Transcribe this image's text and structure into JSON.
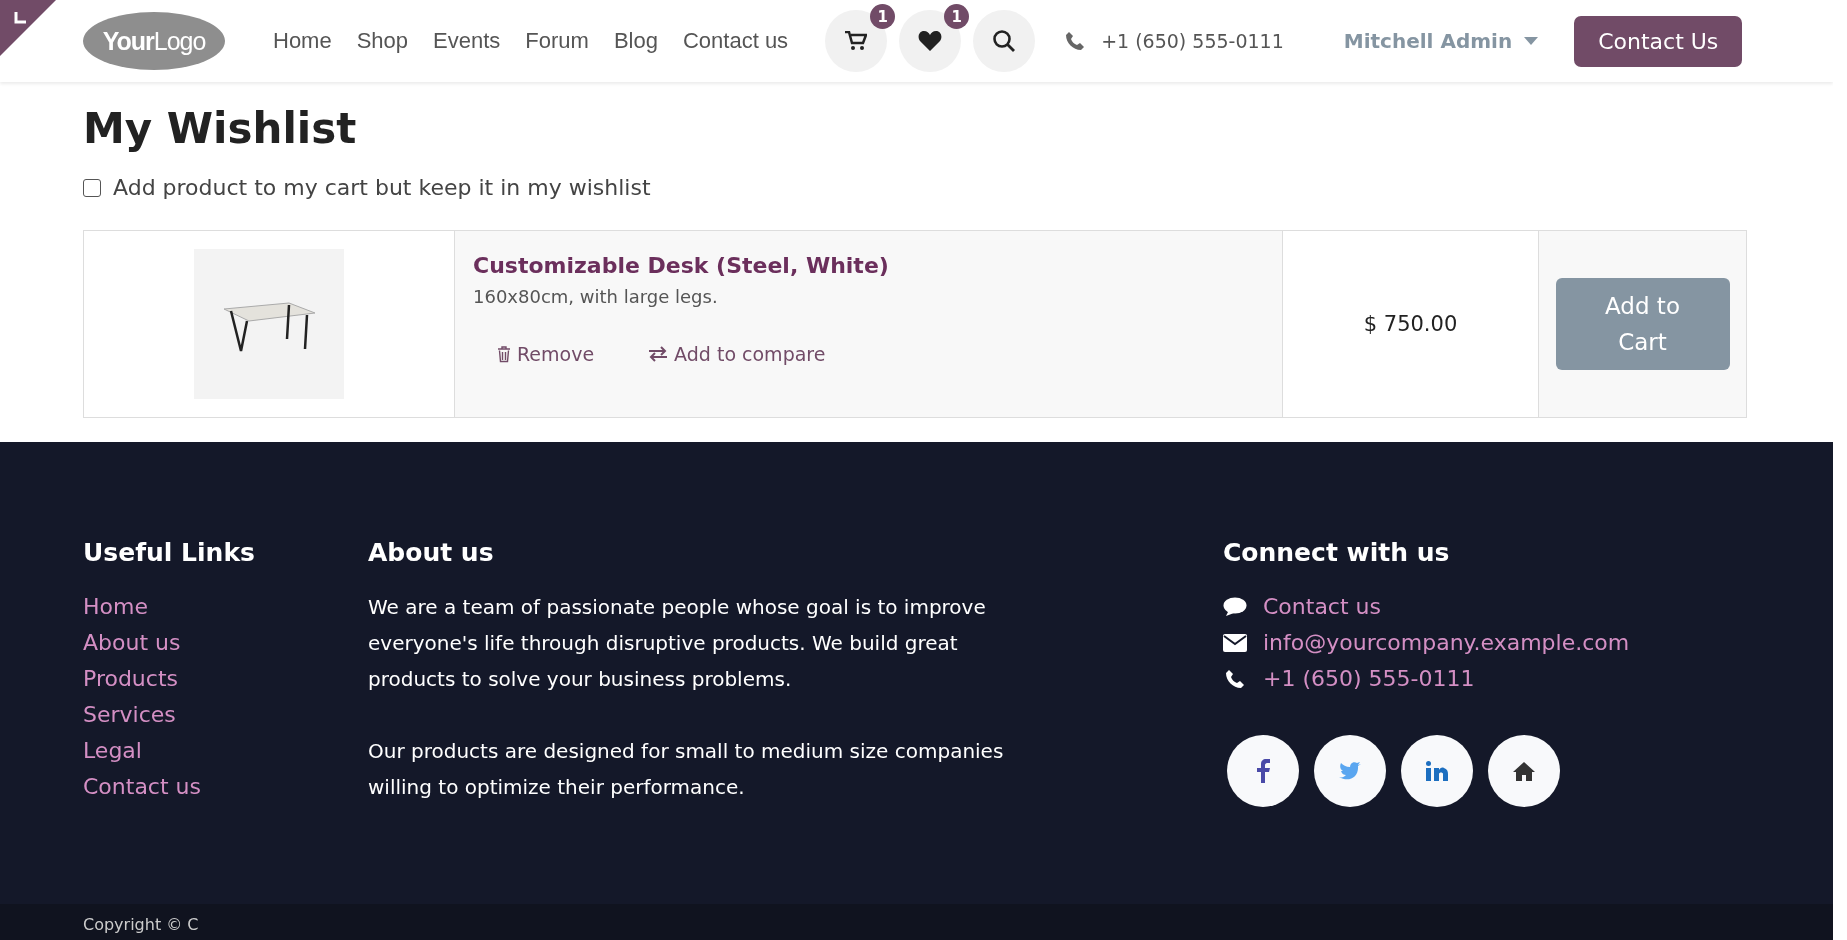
{
  "header": {
    "logo": "**Your**Logo",
    "nav": [
      {
        "label": "Home"
      },
      {
        "label": "Shop"
      },
      {
        "label": "Events"
      },
      {
        "label": "Forum"
      },
      {
        "label": "Blog"
      },
      {
        "label": "Contact us"
      }
    ],
    "cart_count": "1",
    "wishlist_count": "1",
    "phone": "+1 (650) 555-0111",
    "user": "Mitchell Admin",
    "cta": "Contact Us"
  },
  "page": {
    "title": "My Wishlist",
    "keep_in_wishlist": {
      "label": "Add product to my cart but keep it in my wishlist",
      "checked": false
    },
    "items": [
      {
        "name": "Customizable Desk (Steel, White)",
        "description": "160x80cm, with large legs.",
        "remove": "Remove",
        "compare": "Add to compare",
        "price": "$ 750.00",
        "add_to_cart": "Add to Cart"
      }
    ]
  },
  "footer": {
    "useful_links": {
      "title": "Useful Links",
      "links": [
        "Home",
        "About us",
        "Products",
        "Services",
        "Legal",
        "Contact us"
      ]
    },
    "about": {
      "title": "About us",
      "paragraphs": [
        "We are a team of passionate people whose goal is to improve everyone's life through disruptive products. We build great products to solve your business problems.",
        "Our products are designed for small to medium size companies willing to optimize their performance."
      ]
    },
    "connect": {
      "title": "Connect with us",
      "items": [
        {
          "kind": "chat",
          "text": "Contact us"
        },
        {
          "kind": "mail",
          "text": "info@yourcompany.example.com"
        },
        {
          "kind": "phone",
          "text": "+1 (650) 555-0111"
        }
      ],
      "social": [
        {
          "kind": "facebook"
        },
        {
          "kind": "twitter"
        },
        {
          "kind": "linkedin"
        },
        {
          "kind": "home"
        }
      ]
    },
    "copyright": "Copyright © C"
  }
}
